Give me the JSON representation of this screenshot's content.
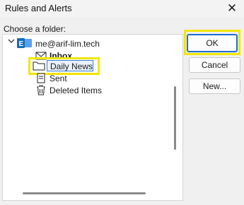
{
  "window": {
    "title": "Rules and Alerts",
    "close_glyph": "✕"
  },
  "folder_picker": {
    "label": "Choose a folder:"
  },
  "tree": {
    "account": {
      "label": "me@arif-lim.tech",
      "icon": "exchange-icon",
      "expanded": true
    },
    "folders": [
      {
        "label": "Inbox",
        "icon": "inbox-icon",
        "bold": true
      },
      {
        "label": "Daily News",
        "icon": "folder-icon",
        "selected": true
      },
      {
        "label": "Sent",
        "icon": "sent-icon"
      },
      {
        "label": "Deleted Items",
        "icon": "trash-icon"
      }
    ]
  },
  "buttons": {
    "ok": "OK",
    "cancel": "Cancel",
    "new": "New..."
  },
  "colors": {
    "highlight": "#f2e600",
    "accent": "#1a6fd1",
    "exchange": "#0f6cbd"
  }
}
